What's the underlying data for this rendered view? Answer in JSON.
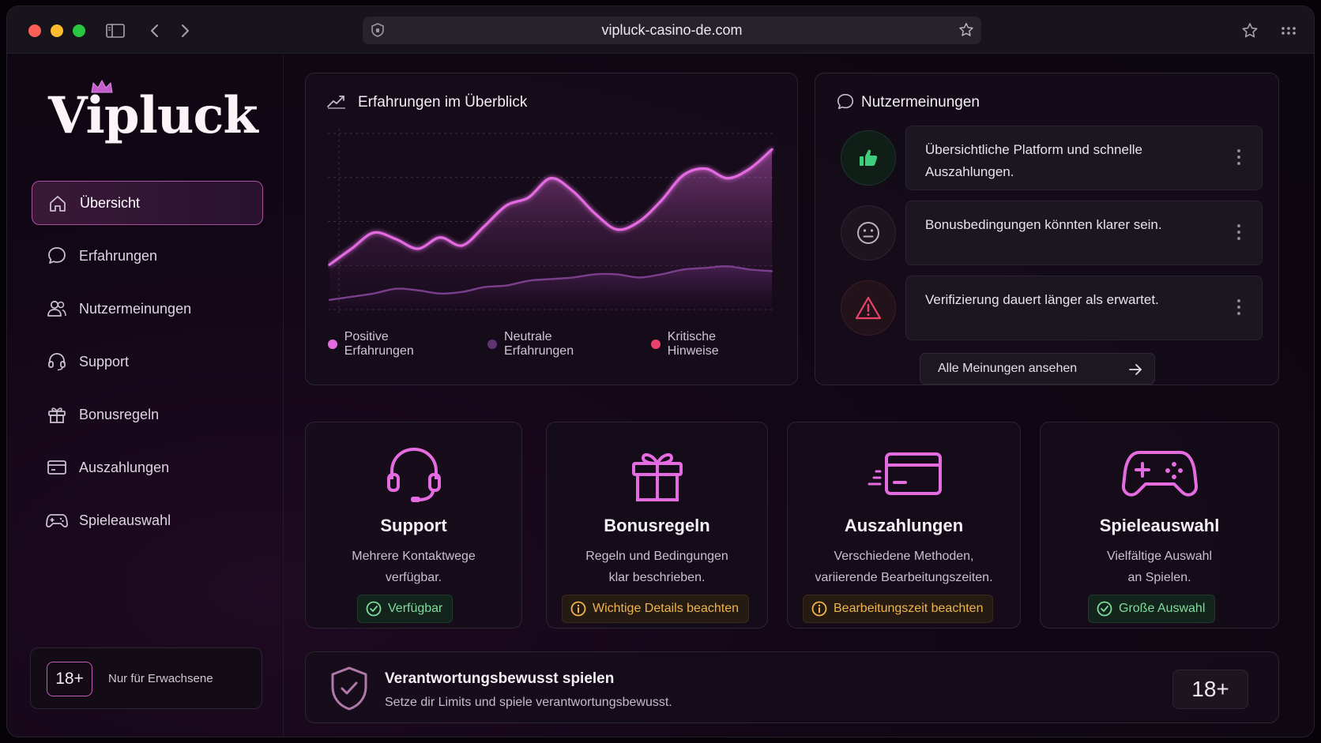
{
  "browser": {
    "url": "vipluck-casino-de.com",
    "icons": [
      "sidebar-toggle-icon",
      "back-icon",
      "forward-icon",
      "shield-icon",
      "bookmark-star-icon",
      "favorites-star-icon",
      "more-grid-icon"
    ]
  },
  "sidebar": {
    "logo": "Vipluck",
    "items": [
      {
        "label": "Übersicht",
        "icon": "home-icon",
        "active": true
      },
      {
        "label": "Erfahrungen",
        "icon": "chat-bubble-icon"
      },
      {
        "label": "Nutzermeinungen",
        "icon": "users-icon"
      },
      {
        "label": "Support",
        "icon": "headset-icon"
      },
      {
        "label": "Bonusregeln",
        "icon": "gift-icon"
      },
      {
        "label": "Auszahlungen",
        "icon": "card-icon"
      },
      {
        "label": "Spieleauswahl",
        "icon": "gamepad-icon"
      }
    ],
    "adult_badge": "18+",
    "adult_text": "Nur für Erwachsene"
  },
  "chart_panel": {
    "title": "Erfahrungen im Überblick",
    "legend": [
      {
        "label": "Positive Erfahrungen",
        "color": "#e36be0"
      },
      {
        "label": "Neutrale Erfahrungen",
        "color": "#5e3470"
      },
      {
        "label": "Kritische Hinweise",
        "color": "#e8436a"
      }
    ]
  },
  "chart_data": {
    "type": "area",
    "x": [
      0,
      1,
      2,
      3,
      4,
      5,
      6,
      7,
      8,
      9,
      10,
      11,
      12,
      13,
      14,
      15,
      16,
      17,
      18,
      19,
      20
    ],
    "series": [
      {
        "name": "Positive Erfahrungen",
        "values": [
          28,
          38,
          48,
          44,
          38,
          45,
          40,
          52,
          65,
          70,
          82,
          74,
          60,
          50,
          55,
          68,
          84,
          88,
          82,
          88,
          100
        ]
      },
      {
        "name": "Neutrale Erfahrungen",
        "values": [
          6,
          8,
          10,
          13,
          12,
          10,
          11,
          14,
          15,
          18,
          19,
          20,
          22,
          22,
          20,
          22,
          25,
          26,
          27,
          25,
          24
        ]
      }
    ],
    "ylim": [
      0,
      110
    ],
    "grid": true,
    "xlabel": "",
    "ylabel": ""
  },
  "opinions": {
    "title": "Nutzermeinungen",
    "items": [
      {
        "text": "Übersichtliche Platform und schnelle Auszahlungen.",
        "icon": "thumbs-up-icon",
        "tone": "positive",
        "color": "#3ecf7a"
      },
      {
        "text": "Bonusbedingungen könnten klarer sein.",
        "icon": "neutral-face-icon",
        "tone": "neutral",
        "color": "#b8b0be"
      },
      {
        "text": "Verifizierung dauert länger als erwartet.",
        "icon": "warning-icon",
        "tone": "critical",
        "color": "#e8436a"
      }
    ],
    "all_button": "Alle Meinungen ansehen"
  },
  "features": [
    {
      "title": "Support",
      "desc1": "Mehrere Kontaktwege",
      "desc2": "verfügbar.",
      "chip": "Verfügbar",
      "chip_tone": "green",
      "icon": "headset-icon"
    },
    {
      "title": "Bonusregeln",
      "desc1": "Regeln und Bedingungen",
      "desc2": "klar beschrieben.",
      "chip": "Wichtige Details beachten",
      "chip_tone": "amber",
      "icon": "gift-icon"
    },
    {
      "title": "Auszahlungen",
      "desc1": "Verschiedene Methoden,",
      "desc2": "variierende Bearbeitungszeiten.",
      "chip": "Bearbeitungszeit beachten",
      "chip_tone": "amber",
      "icon": "card-icon"
    },
    {
      "title": "Spieleauswahl",
      "desc1": "Vielfältige Auswahl",
      "desc2": "an Spielen.",
      "chip": "Große Auswahl",
      "chip_tone": "green",
      "icon": "gamepad-icon"
    }
  ],
  "responsible": {
    "title": "Verantwortungsbewusst spielen",
    "subtitle": "Setze dir Limits und spiele verantwortungsbewusst.",
    "badge": "18+"
  }
}
